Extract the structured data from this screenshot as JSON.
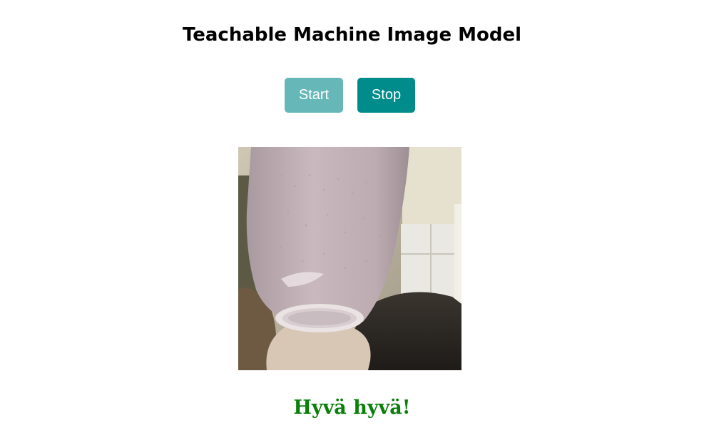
{
  "page": {
    "title": "Teachable Machine Image Model"
  },
  "controls": {
    "start_label": "Start",
    "stop_label": "Stop"
  },
  "result": {
    "label": "Hyvä hyvä!"
  },
  "colors": {
    "start_button": "#66b8b8",
    "stop_button": "#008c8a",
    "result_text": "#0a7f0a"
  }
}
